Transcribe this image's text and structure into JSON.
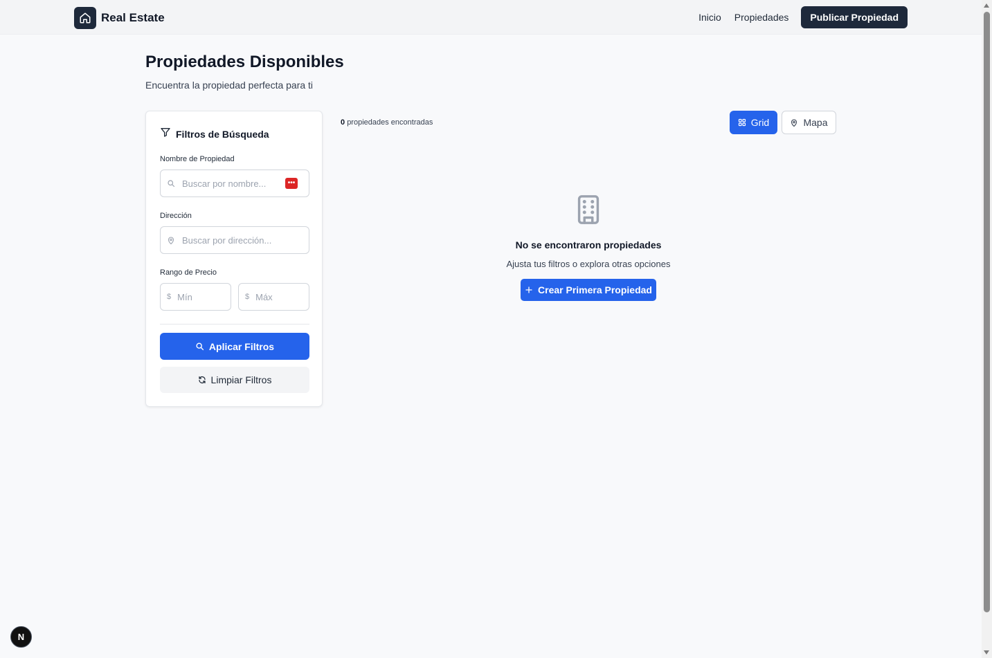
{
  "header": {
    "brand_name": "Real Estate",
    "brand_icon": "home-icon",
    "nav": [
      {
        "label": "Inicio"
      },
      {
        "label": "Propiedades"
      }
    ],
    "publish_label": "Publicar Propiedad"
  },
  "page": {
    "title": "Propiedades Disponibles",
    "subtitle": "Encuentra la propiedad perfecta para ti"
  },
  "filters": {
    "title": "Filtros de Búsqueda",
    "name": {
      "label": "Nombre de Propiedad",
      "placeholder": "Buscar por nombre...",
      "value": ""
    },
    "address": {
      "label": "Dirección",
      "placeholder": "Buscar por dirección...",
      "value": ""
    },
    "price": {
      "label": "Rango de Precio",
      "currency_symbol": "$",
      "min_placeholder": "Mín",
      "max_placeholder": "Máx"
    },
    "apply_label": "Aplicar Filtros",
    "clear_label": "Limpiar Filtros"
  },
  "results": {
    "count": "0",
    "count_label": "propiedades encontradas",
    "view_grid_label": "Grid",
    "view_map_label": "Mapa",
    "active_view": "grid"
  },
  "empty_state": {
    "icon": "building-icon",
    "title": "No se encontraron propiedades",
    "subtitle": "Ajusta tus filtros o explora otras opciones",
    "create_label": "Crear Primera Propiedad"
  },
  "dev_badge": {
    "letter": "N"
  },
  "colors": {
    "primary": "#2563eb",
    "dark": "#1e293b",
    "background": "#f8f9fb",
    "password_manager": "#dc2626"
  }
}
